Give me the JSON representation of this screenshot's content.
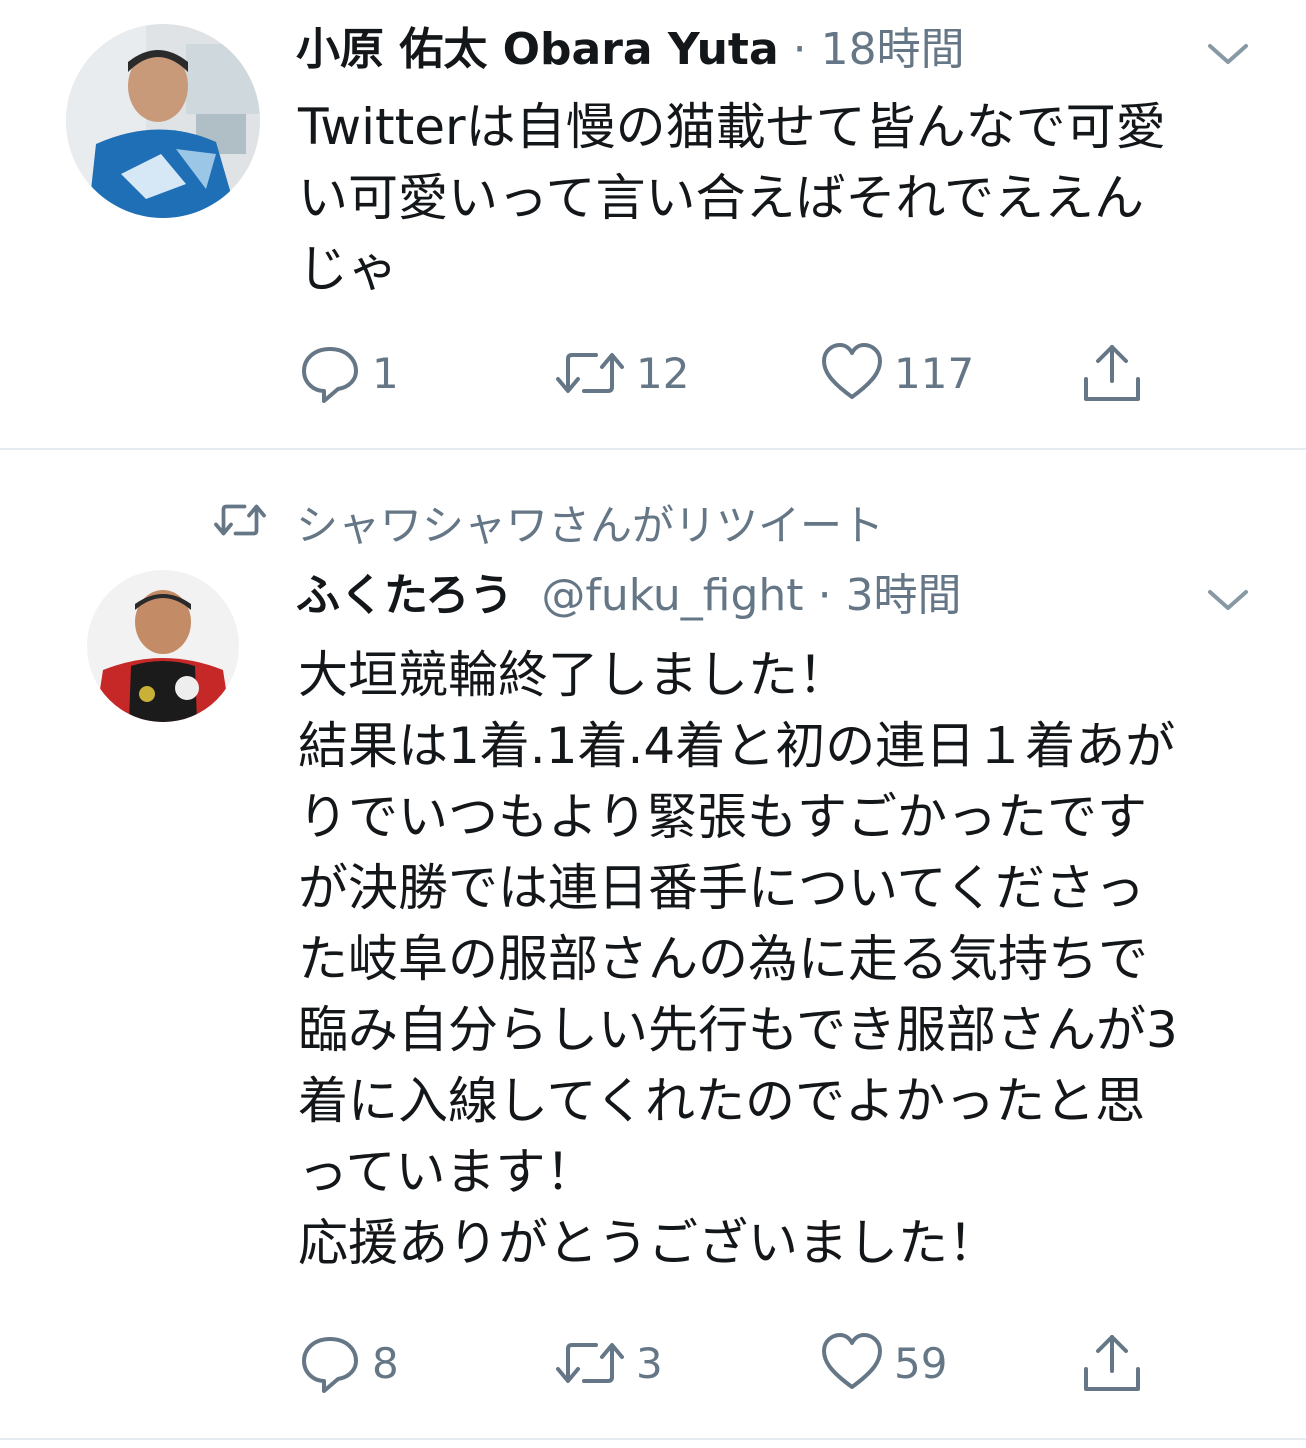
{
  "colors": {
    "text": "#14171a",
    "secondary": "#657786",
    "divider": "#e6ecf0"
  },
  "tweets": [
    {
      "avatar_icon": "avatar-photo",
      "display_name": "小原 佑太 Obara Yuta",
      "handle": "",
      "separator": "·",
      "time": "18時間",
      "text": "Twitterは自慢の猫載せて皆んなで可愛\nい可愛いって言い合えばそれでええん\nじゃ",
      "menu_icon": "chevron-down-icon",
      "actions": {
        "reply_icon": "reply-icon",
        "reply_count": "1",
        "retweet_icon": "retweet-icon",
        "retweet_count": "12",
        "like_icon": "heart-icon",
        "like_count": "117",
        "share_icon": "share-icon"
      }
    },
    {
      "retweeted_by_icon": "retweet-icon",
      "retweeted_by": "シャワシャワさんがリツイート",
      "avatar_icon": "avatar-photo",
      "display_name": "ふくたろう",
      "handle": "@fuku_fight",
      "separator": "·",
      "time": "3時間",
      "text": "大垣競輪終了しました！\n結果は1着.1着.4着と初の連日１着あが\nりでいつもより緊張もすごかったです\nが決勝では連日番手についてくださっ\nた岐阜の服部さんの為に走る気持ちで\n臨み自分らしい先行もでき服部さんが3\n着に入線してくれたのでよかったと思\nっています！\n応援ありがとうございました！",
      "menu_icon": "chevron-down-icon",
      "actions": {
        "reply_icon": "reply-icon",
        "reply_count": "8",
        "retweet_icon": "retweet-icon",
        "retweet_count": "3",
        "like_icon": "heart-icon",
        "like_count": "59",
        "share_icon": "share-icon"
      }
    }
  ]
}
